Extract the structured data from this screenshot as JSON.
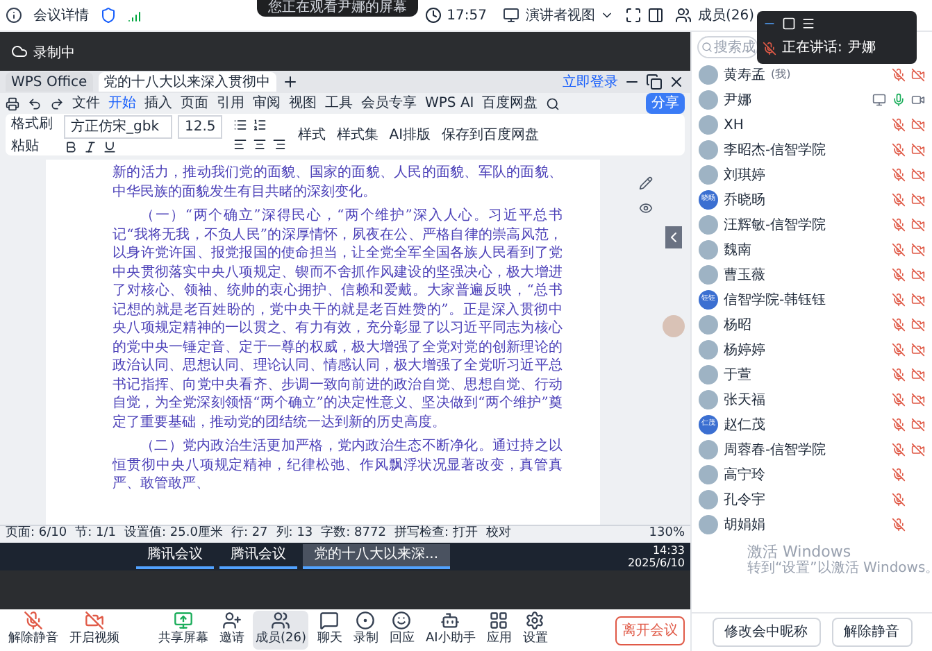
{
  "top_banner": "您正在观看尹娜的屏幕",
  "top_bar": {
    "meeting_details": "会议详情",
    "time": "17:57",
    "view_mode": "演讲者视图",
    "members": "成员(26)"
  },
  "speaking_panel": {
    "label": "正在讲话:",
    "speaker": "尹娜"
  },
  "recording": "录制中",
  "shared_screen": {
    "app_tabs": [
      {
        "label": "WPS Office",
        "selected": false
      },
      {
        "label": "党的十八大以来深入贯彻中",
        "selected": true
      }
    ],
    "login": "立即登录",
    "menu": [
      {
        "label": "文件",
        "selected": false
      },
      {
        "label": "开始",
        "selected": true
      },
      {
        "label": "插入",
        "selected": false
      },
      {
        "label": "页面",
        "selected": false
      },
      {
        "label": "引用",
        "selected": false
      },
      {
        "label": "审阅",
        "selected": false
      },
      {
        "label": "视图",
        "selected": false
      },
      {
        "label": "工具",
        "selected": false
      },
      {
        "label": "会员专享",
        "selected": false
      },
      {
        "label": "WPS AI",
        "selected": false
      },
      {
        "label": "百度网盘",
        "selected": false
      }
    ],
    "share": "分享",
    "ribbon": {
      "format_painter": "格式刷",
      "paste": "粘贴",
      "font": "方正仿宋_gbk",
      "size": "12.5",
      "style": "样式",
      "style_set": "样式集",
      "ai_layout": "AI排版",
      "save_cloud": "保存到百度网盘"
    },
    "document": {
      "paragraphs": [
        {
          "indent": false,
          "text": "新的活力，推动我们党的面貌、国家的面貌、人民的面貌、军队的面貌、中华民族的面貌发生有目共睹的深刻变化。"
        },
        {
          "indent": true,
          "text": "（一）“两个确立”深得民心，“两个维护”深入人心。习近平总书记“我将无我，不负人民”的深厚情怀，夙夜在公、严格自律的崇高风范，以身许党许国、报党报国的使命担当，让全党全军全国各族人民看到了党中央贯彻落实中央八项规定、锲而不舍抓作风建设的坚强决心，极大增进了对核心、领袖、统帅的衷心拥护、信赖和爱戴。大家普遍反映，“总书记想的就是老百姓盼的，党中央干的就是老百姓赞的”。正是深入贯彻中央八项规定精神的一以贯之、有力有效，充分彰显了以习近平同志为核心的党中央一锤定音、定于一尊的权威，极大增强了全党对党的创新理论的政治认同、思想认同、理论认同、情感认同，极大增强了全党听习近平总书记指挥、向党中央看齐、步调一致向前进的政治自觉、思想自觉、行动自觉，为全党深刻领悟“两个确立”的决定性意义、坚决做到“两个维护”奠定了重要基础，推动党的团结统一达到新的历史高度。"
        },
        {
          "indent": true,
          "text": "（二）党内政治生活更加严格，党内政治生态不断净化。通过持之以恒贯彻中央八项规定精神，纪律松弛、作风飘浮状况显著改变，真管真严、敢管敢严、"
        }
      ]
    },
    "status_bar": [
      "页面: 6/10",
      "节: 1/1",
      "设置值: 25.0厘米",
      "行: 27",
      "列: 13",
      "字数: 8772",
      "拼写检查: 打开",
      "校对"
    ],
    "zoom": "130%"
  },
  "taskbar": {
    "apps": [
      {
        "label": "腾讯会议",
        "selected": false
      },
      {
        "label": "腾讯会议",
        "selected": false
      },
      {
        "label": "党的十八大以来深...",
        "selected": true
      }
    ],
    "time": "14:33",
    "date": "2025/6/10"
  },
  "toolbar": {
    "items": [
      {
        "kind": "mic",
        "label": "解除静音",
        "selected": false
      },
      {
        "kind": "camera",
        "label": "开启视频",
        "selected": false
      },
      {
        "kind": "share",
        "label": "共享屏幕",
        "selected": false
      },
      {
        "kind": "invite",
        "label": "邀请",
        "selected": false
      },
      {
        "kind": "members",
        "label": "成员(26)",
        "selected": true
      },
      {
        "kind": "chat",
        "label": "聊天",
        "selected": false
      },
      {
        "kind": "record",
        "label": "录制",
        "selected": false
      },
      {
        "kind": "react",
        "label": "回应",
        "selected": false
      },
      {
        "kind": "ai",
        "label": "AI小助手",
        "selected": false
      },
      {
        "kind": "apps",
        "label": "应用",
        "selected": false
      },
      {
        "kind": "settings",
        "label": "设置",
        "selected": false
      }
    ],
    "leave": "离开会议"
  },
  "members_panel": {
    "search_placeholder": "搜索成",
    "members": [
      {
        "kind": "video",
        "name": "黄寿孟",
        "note": "(我)",
        "muted": true,
        "video_off": true,
        "sharing": false
      },
      {
        "kind": "video",
        "name": "尹娜",
        "muted": false,
        "video_off": false,
        "sharing": true
      },
      {
        "kind": "video",
        "name": "XH",
        "muted": true,
        "video_off": true,
        "sharing": false
      },
      {
        "kind": "video",
        "name": "李昭杰-信智学院",
        "muted": true,
        "video_off": true,
        "sharing": false
      },
      {
        "kind": "video",
        "name": "刘琪婷",
        "muted": true,
        "video_off": true,
        "sharing": false
      },
      {
        "kind": "video",
        "name": "乔晓旸",
        "avatar_text": "晓旸",
        "muted": true,
        "video_off": true,
        "sharing": false
      },
      {
        "kind": "video",
        "name": "汪辉敏-信智学院",
        "muted": true,
        "video_off": true,
        "sharing": false
      },
      {
        "kind": "video",
        "name": "魏南",
        "muted": true,
        "video_off": true,
        "sharing": false
      },
      {
        "kind": "video",
        "name": "曹玉薇",
        "muted": true,
        "video_off": true,
        "sharing": false
      },
      {
        "kind": "video",
        "name": "信智学院-韩钰钰",
        "avatar_text": "钰钰",
        "muted": true,
        "video_off": true,
        "sharing": false
      },
      {
        "kind": "video",
        "name": "杨昭",
        "muted": true,
        "video_off": true,
        "sharing": false
      },
      {
        "kind": "video",
        "name": "杨婷婷",
        "muted": true,
        "video_off": true,
        "sharing": false
      },
      {
        "kind": "video",
        "name": "于萱",
        "muted": true,
        "video_off": true,
        "sharing": false
      },
      {
        "kind": "video",
        "name": "张天福",
        "muted": true,
        "video_off": true,
        "sharing": false
      },
      {
        "kind": "video",
        "name": "赵仁茂",
        "avatar_text": "仁茂",
        "muted": true,
        "video_off": true,
        "sharing": false
      },
      {
        "kind": "video",
        "name": "周蓉春-信智学院",
        "muted": true,
        "video_off": true,
        "sharing": false
      },
      {
        "kind": "audio",
        "name": "高宁玲",
        "muted": true,
        "sharing": false
      },
      {
        "kind": "audio",
        "name": "孔令宇",
        "muted": true,
        "sharing": false
      },
      {
        "kind": "audio",
        "name": "胡娟娟",
        "muted": true,
        "sharing": false
      }
    ],
    "buttons": [
      "修改会中昵称",
      "解除静音"
    ]
  },
  "watermark": {
    "title": "激活 Windows",
    "subtitle": "转到“设置”以激活 Windows。"
  }
}
